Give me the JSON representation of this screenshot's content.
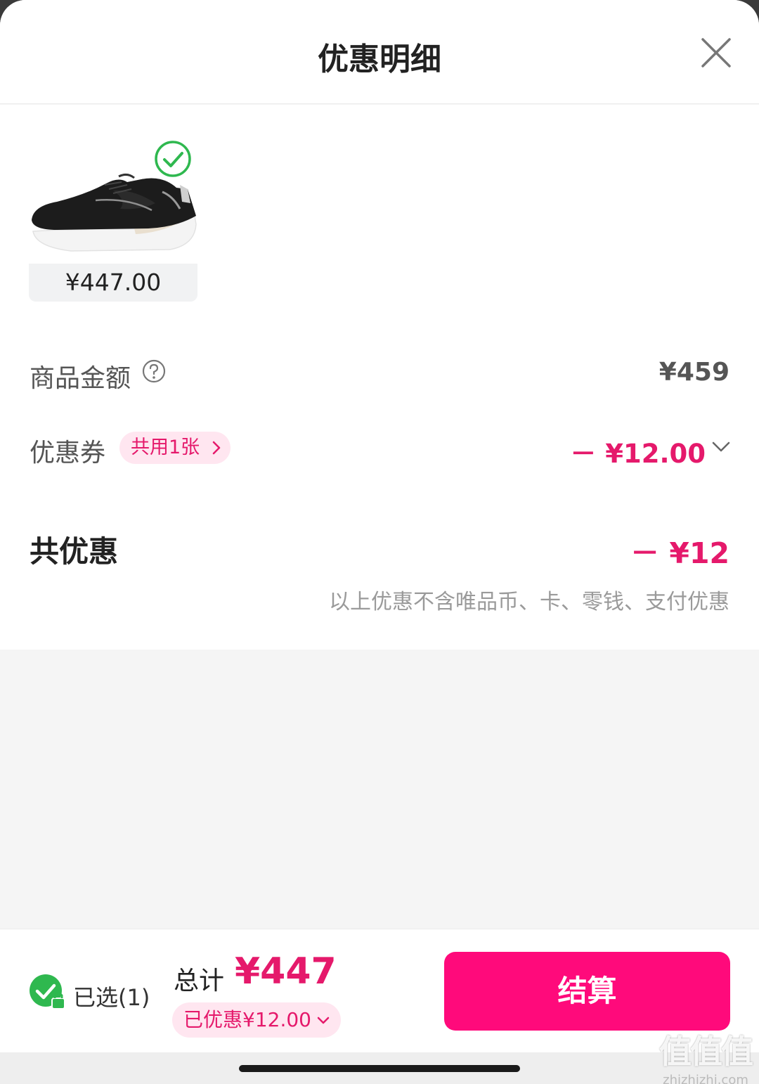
{
  "header": {
    "title": "优惠明细"
  },
  "product": {
    "price": "¥447.00"
  },
  "rows": {
    "goods_amount_label": "商品金额",
    "goods_amount_value": "¥459",
    "coupon_label": "优惠券",
    "coupon_pill": "共用1张",
    "coupon_value": "－ ¥12.00",
    "total_discount_label": "共优惠",
    "total_discount_value": "－ ¥12",
    "note": "以上优惠不含唯品币、卡、零钱、支付优惠"
  },
  "footer": {
    "selected": "已选(1)",
    "total_label": "总计",
    "total_value": "¥447",
    "discount_pill": "已优惠¥12.00",
    "checkout": "结算"
  },
  "watermark": {
    "big": "值值值",
    "small": "zhizhizhi.com"
  },
  "colors": {
    "accent": "#e5196b",
    "button": "#ff0a7b",
    "check": "#2fb84f"
  }
}
